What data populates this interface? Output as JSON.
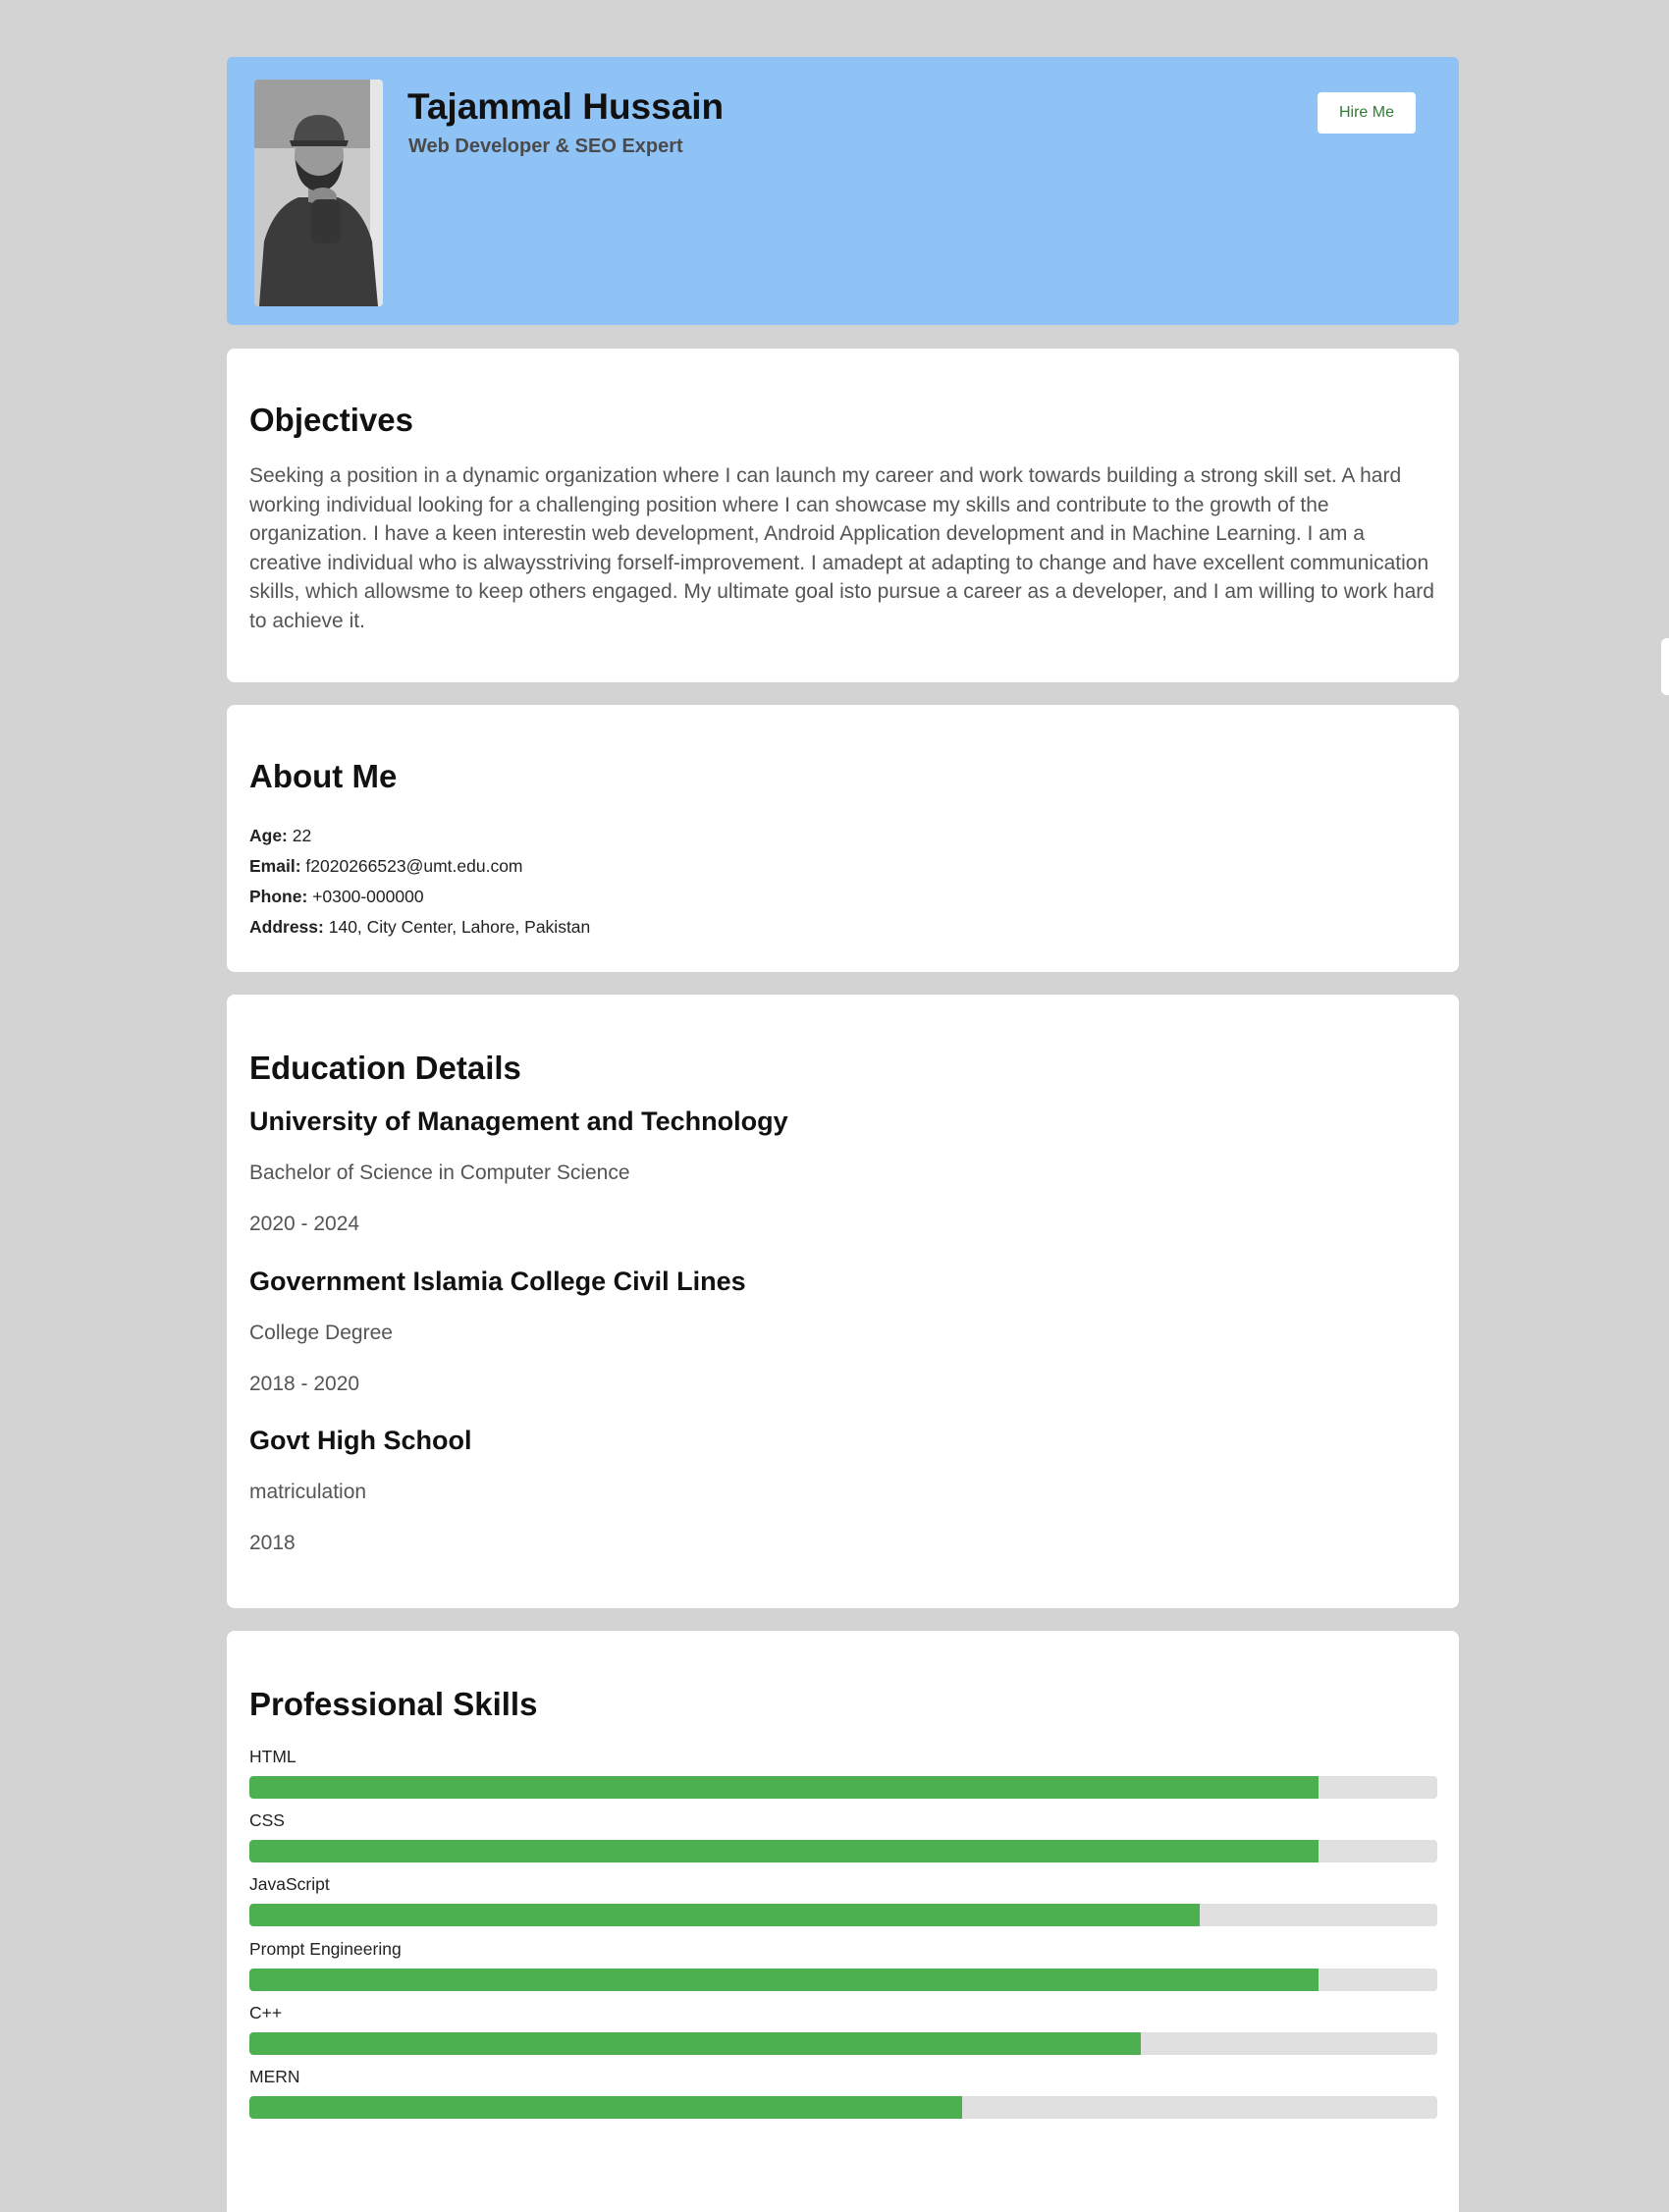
{
  "header": {
    "name": "Tajammal Hussain",
    "role": "Web Developer & SEO Expert",
    "hire_button": "Hire Me"
  },
  "objectives": {
    "title": "Objectives",
    "text": "Seeking a position in a dynamic organization where I can launch my career and work towards building a strong skill set. A hard working individual looking for a challenging position where I can showcase my skills and contribute to the growth of the organization. I have a keen interestin web development, Android Application development and in Machine Learning. I am a creative individual who is alwaysstriving forself-improvement. I amadept at adapting to change and have excellent communication skills, which allowsme to keep others engaged. My ultimate goal isto pursue a career as a developer, and I am willing to work hard to achieve it."
  },
  "about": {
    "title": "About Me",
    "rows": [
      {
        "label": "Age:",
        "value": "22"
      },
      {
        "label": "Email:",
        "value": "f2020266523@umt.edu.com"
      },
      {
        "label": "Phone:",
        "value": "+0300-000000"
      },
      {
        "label": "Address:",
        "value": "140, City Center, Lahore, Pakistan"
      }
    ]
  },
  "education": {
    "title": "Education Details",
    "items": [
      {
        "school": "University of Management and Technology",
        "degree": "Bachelor of Science in Computer Science",
        "years": "2020 - 2024"
      },
      {
        "school": "Government Islamia College Civil Lines",
        "degree": "College Degree",
        "years": "2018 - 2020"
      },
      {
        "school": "Govt High School",
        "degree": "matriculation",
        "years": "2018"
      }
    ]
  },
  "skills": {
    "title": "Professional Skills",
    "items": [
      {
        "name": "HTML",
        "level": 0.9
      },
      {
        "name": "CSS",
        "level": 0.9
      },
      {
        "name": "JavaScript",
        "level": 0.8
      },
      {
        "name": "Prompt Engineering",
        "level": 0.9
      },
      {
        "name": "C++",
        "level": 0.75
      },
      {
        "name": "MERN",
        "level": 0.6
      }
    ]
  },
  "colors": {
    "page_background": "#d3d3d3",
    "header_background": "#90c3f5",
    "skill_fill": "#4caf50",
    "skill_track": "#e0e0e0",
    "hire_button_text": "#2e7d32"
  }
}
